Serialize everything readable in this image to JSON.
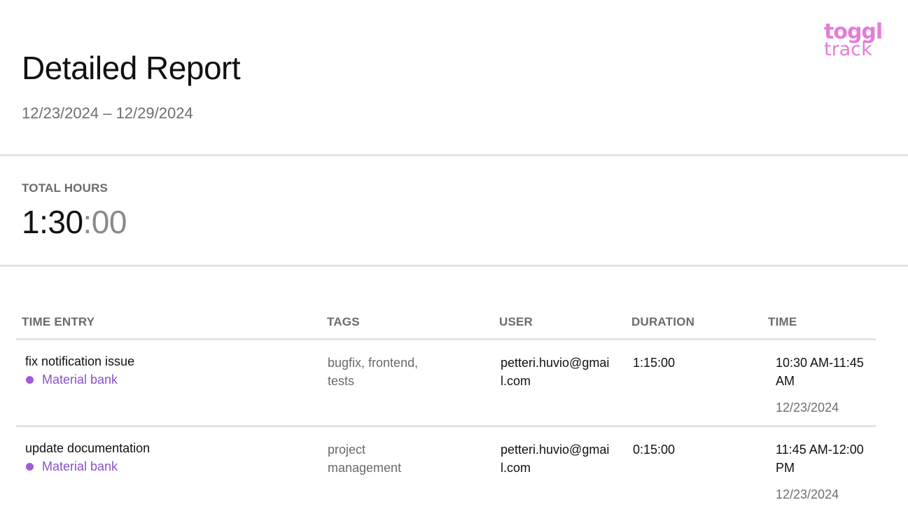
{
  "header": {
    "title": "Detailed Report",
    "date_range": "12/23/2024 – 12/29/2024",
    "logo_top": "toggl",
    "logo_bottom": "track",
    "logo_color": "#e57cd8"
  },
  "totals": {
    "label": "TOTAL HOURS",
    "hours_minutes": "1:30",
    "seconds": ":00"
  },
  "table": {
    "columns": [
      "TIME ENTRY",
      "TAGS",
      "USER",
      "DURATION",
      "TIME"
    ],
    "rows": [
      {
        "description": "fix notification issue",
        "project": "Material bank",
        "project_color": "#a35ad8",
        "tags": "bugfix, frontend, tests",
        "user": "petteri.huvio@gmail.com",
        "duration": "1:15:00",
        "time_range": "10:30 AM-11:45 AM",
        "date": "12/23/2024"
      },
      {
        "description": "update documentation",
        "project": "Material bank",
        "project_color": "#a35ad8",
        "tags": "project management",
        "user": "petteri.huvio@gmail.com",
        "duration": "0:15:00",
        "time_range": "11:45 AM-12:00 PM",
        "date": "12/23/2024"
      }
    ]
  }
}
